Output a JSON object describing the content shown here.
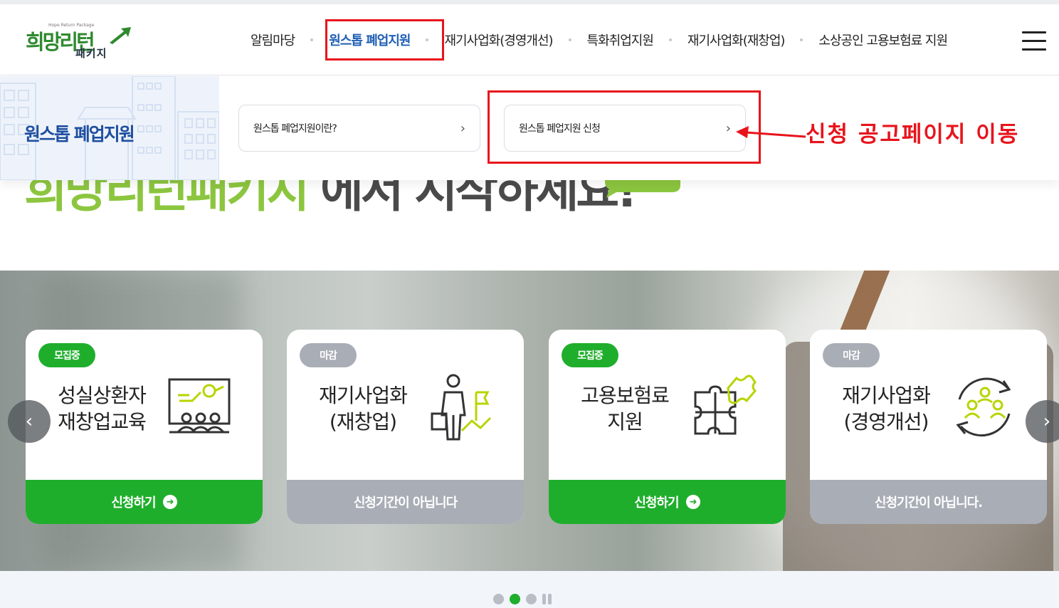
{
  "header": {
    "logo": {
      "small_text": "Hope Return Package",
      "main_text": "희망리턴",
      "sub_text": "패키지"
    },
    "nav": [
      {
        "label": "알림마당",
        "active": false
      },
      {
        "label": "원스톱 폐업지원",
        "active": true
      },
      {
        "label": "재기사업화(경영개선)",
        "active": false
      },
      {
        "label": "특화취업지원",
        "active": false
      },
      {
        "label": "재기사업화(재창업)",
        "active": false
      },
      {
        "label": "소상공인 고용보험료 지원",
        "active": false
      }
    ],
    "menu_icon": "hamburger-icon"
  },
  "hero": {
    "green_text": "희망리턴패키지",
    "dark_text": " 에서 시작하세요!"
  },
  "submenu": {
    "title": "원스톱 폐업지원",
    "items": [
      {
        "label": "원스톱 폐업지원이란?",
        "icon": "chevron-right-icon",
        "chevron": "›"
      },
      {
        "label": "원스톱 폐업지원 신청",
        "icon": "chevron-right-icon",
        "chevron": "›"
      }
    ]
  },
  "annotation": {
    "text": "신청 공고페이지 이동",
    "color": "#e8141c"
  },
  "cards": [
    {
      "status": "모집중",
      "title_line1": "성실상환자",
      "title_line2": "재창업교육",
      "button": "신청하기",
      "icon": "presentation-icon",
      "open": true
    },
    {
      "status": "마감",
      "title_line1": "재기사업화",
      "title_line2": "(재창업)",
      "button": "신청기간이 아닙니다",
      "icon": "businessman-flag-icon",
      "open": false
    },
    {
      "status": "모집중",
      "title_line1": "고용보험료",
      "title_line2": "지원",
      "button": "신청하기",
      "icon": "puzzle-icon",
      "open": true
    },
    {
      "status": "마감",
      "title_line1": "재기사업화",
      "title_line2": "(경영개선)",
      "button": "신청기간이 아닙니다.",
      "icon": "team-cycle-icon",
      "open": false
    }
  ],
  "carousel": {
    "prev": "‹",
    "next": "›",
    "active_dot": 1,
    "dot_count": 2
  },
  "colors": {
    "brand_green": "#1fae2c",
    "brand_blue": "#1f5fb5",
    "closed_gray": "#a8adb6",
    "highlight_red": "#e8141c"
  }
}
